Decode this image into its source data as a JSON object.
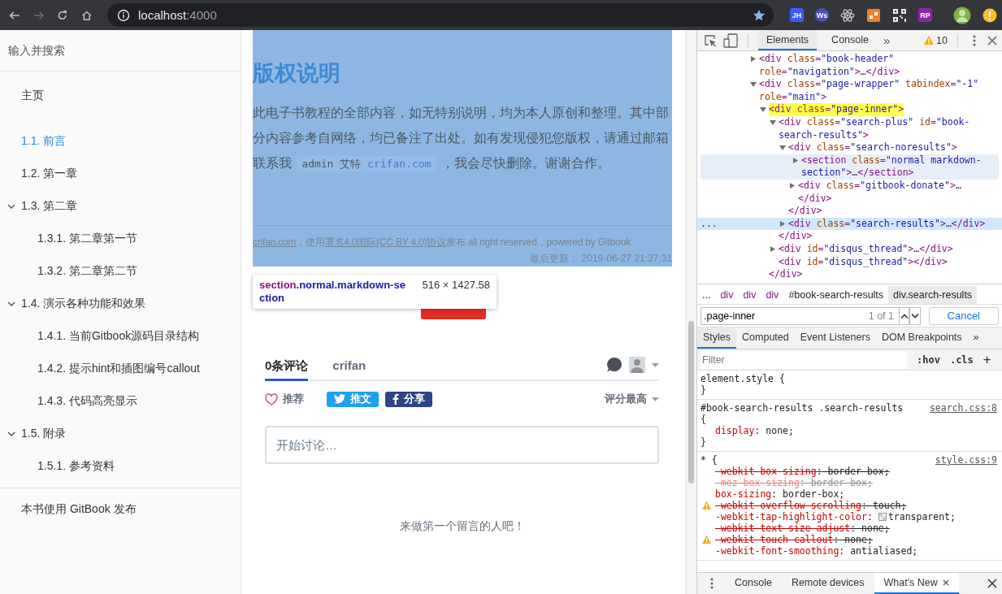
{
  "browser": {
    "nav": [
      {
        "kind": "back",
        "disabled": false
      },
      {
        "kind": "forward",
        "disabled": true
      },
      {
        "kind": "reload",
        "disabled": false
      },
      {
        "kind": "home",
        "disabled": false
      }
    ],
    "address": {
      "host": "localhost",
      "port": ":4000"
    },
    "extensions": [
      {
        "kind": "label",
        "text": "JH",
        "color": "#3d5afe"
      },
      {
        "kind": "label",
        "text": "Ws",
        "color": "#4b4fbf"
      },
      {
        "kind": "atom"
      },
      {
        "kind": "tile",
        "color": "#f48024"
      },
      {
        "kind": "qr"
      },
      {
        "kind": "label",
        "text": "RP",
        "color": "#8e24aa"
      },
      {
        "kind": "avatar"
      },
      {
        "kind": "warning"
      }
    ]
  },
  "sidebar": {
    "search_placeholder": "输入并搜索",
    "items": [
      {
        "label": "主页",
        "selected": false
      },
      {
        "label": "1.1. 前言",
        "selected": true
      },
      {
        "label": "1.2. 第一章",
        "selected": false
      },
      {
        "label": "1.3. 第二章",
        "selected": false,
        "expanded": true,
        "children": [
          {
            "label": "1.3.1. 第二章第一节",
            "selected": false
          },
          {
            "label": "1.3.2. 第二章第二节",
            "selected": false
          }
        ]
      },
      {
        "label": "1.4. 演示各种功能和效果",
        "selected": false,
        "expanded": true,
        "children": [
          {
            "label": "1.4.1. 当前Gitbook源码目录结构",
            "selected": false
          },
          {
            "label": "1.4.2. 提示hint和插图编号callout",
            "selected": false
          },
          {
            "label": "1.4.3. 代码高亮显示",
            "selected": false
          }
        ]
      },
      {
        "label": "1.5. 附录",
        "selected": false,
        "expanded": true,
        "children": [
          {
            "label": "1.5.1. 参考资料",
            "selected": false
          }
        ]
      }
    ],
    "footer_link": "本书使用 GitBook 发布"
  },
  "page": {
    "title": "版权说明",
    "paragraph": {
      "before": "此电子书教程的全部内容，如无特别说明，均为本人原创和整理。其中部分内容参考自网络，均已备注了出处。如有发现侵犯您版权，请通过邮箱联系我 ",
      "code": "admin 艾特 ",
      "link": "crifan.com",
      "after": " ，我会尽快删除。谢谢合作。"
    },
    "footer": {
      "site_link": "crifan.com",
      "text_1": "，使用",
      "license_link": "署名4.0国际(CC BY 4.0)协议",
      "text_2": "发布 all right reserved，powered by Gitbook",
      "updated": "最后更新：  2019-06-27 21:37:31"
    },
    "tooltip": {
      "tag": "section",
      "classes": ".normal.markdown-section",
      "size": "516 × 1427.58"
    },
    "comments": {
      "tabs": [
        {
          "label": "0条评论",
          "selected": true
        },
        {
          "label": "crifan",
          "selected": false
        }
      ],
      "recommend": "推荐",
      "tweet": "推文",
      "share": "分享",
      "sort": "评分最高",
      "placeholder": "开始讨论…",
      "empty": "来做第一个留言的人吧！"
    }
  },
  "devtools": {
    "tabs": [
      {
        "label": "Elements",
        "selected": true
      },
      {
        "label": "Console",
        "selected": false
      }
    ],
    "overflow": "»",
    "warnings": "10",
    "tree": [
      {
        "tokens": [
          {
            "kind": "tag",
            "text": "<div"
          },
          {
            "kind": "attr",
            "text": " class"
          },
          {
            "kind": "tag",
            "text": "="
          },
          {
            "kind": "value",
            "text": "\"book-header\""
          },
          {
            "kind": "attr",
            "text": " role"
          },
          {
            "kind": "tag",
            "text": "="
          },
          {
            "kind": "value",
            "text": "\"navigation\""
          },
          {
            "kind": "tag",
            "text": ">"
          },
          {
            "kind": "text",
            "text": "…"
          },
          {
            "kind": "tag",
            "text": "</div>"
          }
        ],
        "expanded": false,
        "selected": false,
        "hovered": false,
        "highlighted": false
      },
      {
        "tokens": [
          {
            "kind": "tag",
            "text": "<div"
          },
          {
            "kind": "attr",
            "text": " class"
          },
          {
            "kind": "tag",
            "text": "="
          },
          {
            "kind": "value",
            "text": "\"page-wrapper\""
          },
          {
            "kind": "attr",
            "text": " tabindex"
          },
          {
            "kind": "tag",
            "text": "="
          },
          {
            "kind": "value",
            "text": "\"-1\""
          },
          {
            "kind": "attr",
            "text": " role"
          },
          {
            "kind": "tag",
            "text": "="
          },
          {
            "kind": "value",
            "text": "\"main\""
          },
          {
            "kind": "tag",
            "text": ">"
          }
        ],
        "expanded": true,
        "selected": false,
        "hovered": false,
        "highlighted": false,
        "children": [
          {
            "tokens": [
              {
                "kind": "tag",
                "text": "<div"
              },
              {
                "kind": "attr",
                "text": " class"
              },
              {
                "kind": "tag",
                "text": "="
              },
              {
                "kind": "value",
                "text": "\"page-inner\""
              },
              {
                "kind": "tag",
                "text": ">"
              }
            ],
            "expanded": true,
            "selected": false,
            "hovered": false,
            "highlighted": true,
            "close": [
              {
                "kind": "tag",
                "text": "</div>"
              }
            ],
            "children": [
              {
                "tokens": [
                  {
                    "kind": "tag",
                    "text": "<div"
                  },
                  {
                    "kind": "attr",
                    "text": " class"
                  },
                  {
                    "kind": "tag",
                    "text": "="
                  },
                  {
                    "kind": "value",
                    "text": "\"search-plus\""
                  },
                  {
                    "kind": "attr",
                    "text": " id"
                  },
                  {
                    "kind": "tag",
                    "text": "="
                  },
                  {
                    "kind": "value",
                    "text": "\"book-search-results\""
                  },
                  {
                    "kind": "tag",
                    "text": ">"
                  }
                ],
                "expanded": true,
                "selected": false,
                "hovered": false,
                "highlighted": false,
                "close": [
                  {
                    "kind": "tag",
                    "text": "</div>"
                  }
                ],
                "children": [
                  {
                    "tokens": [
                      {
                        "kind": "tag",
                        "text": "<div"
                      },
                      {
                        "kind": "attr",
                        "text": " class"
                      },
                      {
                        "kind": "tag",
                        "text": "="
                      },
                      {
                        "kind": "value",
                        "text": "\"search-noresults\""
                      },
                      {
                        "kind": "tag",
                        "text": ">"
                      }
                    ],
                    "expanded": true,
                    "selected": false,
                    "hovered": false,
                    "highlighted": false,
                    "close": [
                      {
                        "kind": "tag",
                        "text": "</div>"
                      }
                    ],
                    "children": [
                      {
                        "tokens": [
                          {
                            "kind": "tag",
                            "text": "<section"
                          },
                          {
                            "kind": "attr",
                            "text": " class"
                          },
                          {
                            "kind": "tag",
                            "text": "="
                          },
                          {
                            "kind": "value",
                            "text": "\"normal markdown-section\""
                          },
                          {
                            "kind": "tag",
                            "text": ">"
                          },
                          {
                            "kind": "text",
                            "text": "…"
                          },
                          {
                            "kind": "tag",
                            "text": "</section>"
                          }
                        ],
                        "expanded": false,
                        "selected": false,
                        "hovered": true,
                        "highlighted": false
                      },
                      {
                        "tokens": [
                          {
                            "kind": "tag",
                            "text": "<div"
                          },
                          {
                            "kind": "attr",
                            "text": " class"
                          },
                          {
                            "kind": "tag",
                            "text": "="
                          },
                          {
                            "kind": "value",
                            "text": "\"gitbook-donate\""
                          },
                          {
                            "kind": "tag",
                            "text": ">"
                          },
                          {
                            "kind": "text",
                            "text": "…"
                          },
                          {
                            "kind": "tag",
                            "text": " </div>"
                          }
                        ],
                        "expanded": false,
                        "selected": false,
                        "hovered": false,
                        "highlighted": false
                      }
                    ]
                  },
                  {
                    "gutter": "...",
                    "tokens": [
                      {
                        "kind": "tag",
                        "text": "<div"
                      },
                      {
                        "kind": "attr",
                        "text": " class"
                      },
                      {
                        "kind": "tag",
                        "text": "="
                      },
                      {
                        "kind": "value",
                        "text": "\"search-results\""
                      },
                      {
                        "kind": "tag",
                        "text": ">"
                      },
                      {
                        "kind": "text",
                        "text": "…"
                      },
                      {
                        "kind": "tag",
                        "text": "</div>"
                      }
                    ],
                    "expanded": false,
                    "selected": true,
                    "hovered": false,
                    "highlighted": false
                  }
                ]
              },
              {
                "tokens": [
                  {
                    "kind": "tag",
                    "text": "<div"
                  },
                  {
                    "kind": "attr",
                    "text": " id"
                  },
                  {
                    "kind": "tag",
                    "text": "="
                  },
                  {
                    "kind": "value",
                    "text": "\"disqus_thread\""
                  },
                  {
                    "kind": "tag",
                    "text": ">"
                  },
                  {
                    "kind": "text",
                    "text": "…"
                  },
                  {
                    "kind": "tag",
                    "text": "</div>"
                  }
                ],
                "expanded": false,
                "selected": false,
                "hovered": false,
                "highlighted": false
              },
              {
                "tokens": [
                  {
                    "kind": "tag",
                    "text": "<div"
                  },
                  {
                    "kind": "attr",
                    "text": " id"
                  },
                  {
                    "kind": "tag",
                    "text": "="
                  },
                  {
                    "kind": "value",
                    "text": "\"disqus_thread\""
                  },
                  {
                    "kind": "tag",
                    "text": "></div>"
                  }
                ],
                "selected": false,
                "hovered": false,
                "highlighted": false
              }
            ]
          }
        ]
      }
    ],
    "breadcrumbs": [
      {
        "kind": "more",
        "text": "...",
        "selected": false
      },
      {
        "kind": "tag",
        "text": "div",
        "selected": false
      },
      {
        "kind": "tag",
        "text": "div",
        "selected": false
      },
      {
        "kind": "tag",
        "text": "div",
        "selected": false
      },
      {
        "kind": "selector",
        "text": "#book-search-results",
        "selected": false
      },
      {
        "kind": "selector",
        "text": "div.search-results",
        "selected": true
      }
    ],
    "search": {
      "value": ".page-inner",
      "count": "1 of 1",
      "cancel": "Cancel"
    },
    "panes": [
      {
        "label": "Styles",
        "selected": true
      },
      {
        "label": "Computed",
        "selected": false
      },
      {
        "label": "Event Listeners",
        "selected": false
      },
      {
        "label": "DOM Breakpoints",
        "selected": false
      }
    ],
    "panes_overflow": "»",
    "filter": {
      "placeholder": "Filter",
      "hov": ":hov",
      "cls": ".cls",
      "add": "+"
    },
    "rules": [
      {
        "selector": "element.style {",
        "close": "}"
      },
      {
        "selector": "#book-search-results .search-results",
        "source": "search.css:8",
        "open": "{",
        "close": "}",
        "properties": [
          {
            "name": "display",
            "colon": ":",
            "value": " none;",
            "overridden": false
          }
        ]
      },
      {
        "selector": "* {",
        "source": "style.css:9",
        "properties": [
          {
            "name": "-webkit-box-sizing",
            "colon": ":",
            "value": " border-box;",
            "overridden": true
          },
          {
            "name": "-moz-box-sizing",
            "colon": ":",
            "value": " border-box;",
            "overridden": true,
            "inactive": true
          },
          {
            "name": "box-sizing",
            "colon": ":",
            "value": " border-box;",
            "overridden": false
          },
          {
            "name": "-webkit-overflow-scrolling",
            "colon": ":",
            "value": " touch;",
            "overridden": true,
            "warning": true
          },
          {
            "name": "-webkit-tap-highlight-color",
            "colon": ":",
            "value": "transparent;",
            "overridden": false,
            "swatch": true
          },
          {
            "name": "-webkit-text-size-adjust",
            "colon": ":",
            "value": " none;",
            "overridden": true
          },
          {
            "name": "-webkit-touch-callout",
            "colon": ":",
            "value": " none;",
            "overridden": true,
            "warning": true
          },
          {
            "name": "-webkit-font-smoothing",
            "colon": ":",
            "value": " antialiased;",
            "overridden": false
          }
        ]
      }
    ],
    "drawer": {
      "tabs": [
        {
          "label": "Console",
          "selected": false
        },
        {
          "label": "Remote devices",
          "selected": false
        },
        {
          "label": "What's New",
          "selected": true,
          "closable": true
        }
      ]
    }
  }
}
